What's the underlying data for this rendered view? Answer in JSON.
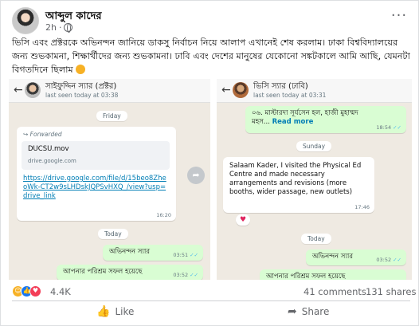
{
  "post": {
    "author": "আব্দুল কাদের",
    "timestamp": "2h",
    "caption": "ভিসি এবং প্রক্টরকে অভিনন্দন জানিয়ে ডাকসু নির্বাচন নিয়ে আলাপ এখানেই শেষ করলাম। ঢাকা বিশ্ববিদ্যালয়ের জন্য শুভকামনা, শিক্ষার্থীদের জন্য শুভকামনা। ঢাবি এবং দেশের মানুষের যেকোনো সঙ্কটকালে আমি আছি, যেমনটা বিগতদিনে ছিলাম"
  },
  "left_chat": {
    "contact_name": "সাইফুদ্দিন স্যার (প্রক্টর)",
    "status": "last seen today at 03:38",
    "date_friday": "Friday",
    "forwarded_label": "Forwarded",
    "file_name": "DUCSU.mov",
    "file_domain": "drive.google.com",
    "link_text": "https://drive.google.com/file/d/15beo8ZheoWk-CT2w9sLHDskJQPSvHXQ_/view?usp=drive_link",
    "link_time": "16:20",
    "date_today": "Today",
    "msg1_text": "অভিনন্দন স্যার",
    "msg1_time": "03:51",
    "msg2_text": "আপনার পরিশ্রম সফল হয়েছে",
    "msg2_time": "03:52"
  },
  "right_chat": {
    "contact_name": "ভিসি স্যার (ঢাবি)",
    "status": "last seen today at 03:31",
    "msg0_text": "০৬. মাস্টারদা সূর্যসেন হল, হাজী মুহাম্মদ মহস...",
    "msg0_read_more": "Read more",
    "msg0_time": "18:54",
    "date_sunday": "Sunday",
    "msg_sunday_text": "Salaam Kader, I visited the Physical Ed Centre and made necessary arrangements and revisions (more booths, wider passage, new outlets)",
    "msg_sunday_time": "17:46",
    "date_today": "Today",
    "msg1_text": "অভিনন্দন স্যার",
    "msg1_time": "03:52",
    "msg2_text": "আপনার পরিশ্রম সফল হয়েছে"
  },
  "stats": {
    "reactions": "4.4K",
    "comments": "41 comments",
    "shares": "131 shares"
  },
  "actions": {
    "like": "Like",
    "share": "Share"
  },
  "colors": {
    "chat_background": "#efeae2",
    "outgoing_bubble": "#d9fdd3",
    "link": "#027eb5",
    "read_ticks": "#53bdeb"
  }
}
